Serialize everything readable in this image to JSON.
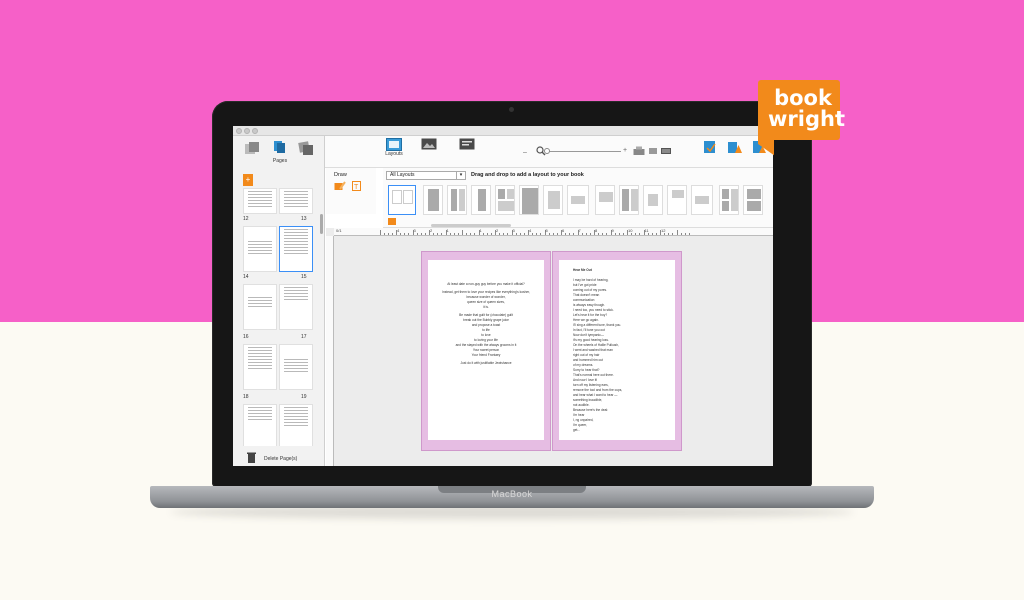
{
  "brand": {
    "logo_line1": "book",
    "logo_line2": "wright",
    "device_label": "MacBook",
    "colors": {
      "background_pink": "#f660c8",
      "background_cream": "#fcfaf3",
      "logo_orange": "#f28a1b"
    }
  },
  "toolbar": {
    "layouts_label": "Layouts",
    "zoom_level_fraction": 0.0
  },
  "sidebar": {
    "pages_label": "Pages",
    "spreads": [
      {
        "left": "12",
        "right": "13"
      },
      {
        "left": "",
        "right": ""
      },
      {
        "left": "14",
        "right": "15"
      },
      {
        "left": "16",
        "right": "17"
      },
      {
        "left": "18",
        "right": "19"
      }
    ],
    "delete_label": "Delete Page(s)"
  },
  "draw_panel": {
    "title": "Draw"
  },
  "layouts_panel": {
    "dropdown_value": "All Layouts",
    "hint": "Drag and drop to add a layout to your book"
  },
  "ruler": {
    "origin": "0/1",
    "left_labels": [
      "4",
      "3",
      "2",
      "1"
    ],
    "right_labels": [
      "1",
      "2",
      "3",
      "4",
      "5",
      "6",
      "7",
      "8",
      "9",
      "10",
      "11",
      "12"
    ]
  },
  "left_page": {
    "lines": [
      "At least date a non-guy guy before you make it official?",
      "",
      "Instead, get them to love your recipes like everything's kosher,",
      "because wonder of wonder,",
      "queen size of queen sizes,",
      "it is.",
      "",
      "Be made that guilt for (chocolate) guilt",
      "break out the Bubbly grape juice",
      "and propose a toast",
      "to life",
      "to love",
      "to loving your life",
      "and the stayed with the always grooms in it",
      "Your sweet person",
      "Your friend Frontaey",
      "",
      "Just do it with justifiable Jewishance"
    ]
  },
  "right_page": {
    "title": "Hear Me Out",
    "lines": [
      "I may be hard of hearing,",
      "but I've got pride",
      "coming out of my pores.",
      "That doesn't mean",
      "communication",
      "is always easy though.",
      "I need too, you need to stick.",
      "Let's hear it for the boy?",
      "Here we go again.",
      "I'll sing a different tune, thank you.",
      "In fact, I'll tune you out",
      "Now don't tympanic—",
      "it's my good hearing loss.",
      "On the wheels of Hallie Pulkush,",
      "I went and washed that man",
      "right out of my hair",
      "and hummed him out",
      "of my dreams.",
      "Sorry to hear that?",
      "That's normal here out there.",
      "And now I love it!",
      "turn off my listening ears,",
      "remove the tool and from the cups,",
      "and hear what I want to hear —",
      "something inaudible,",
      "not audible.",
      "Because here's the deal:",
      "I'm hear",
      "I, ng unpaired,",
      "I'm queer,",
      "get..."
    ]
  }
}
